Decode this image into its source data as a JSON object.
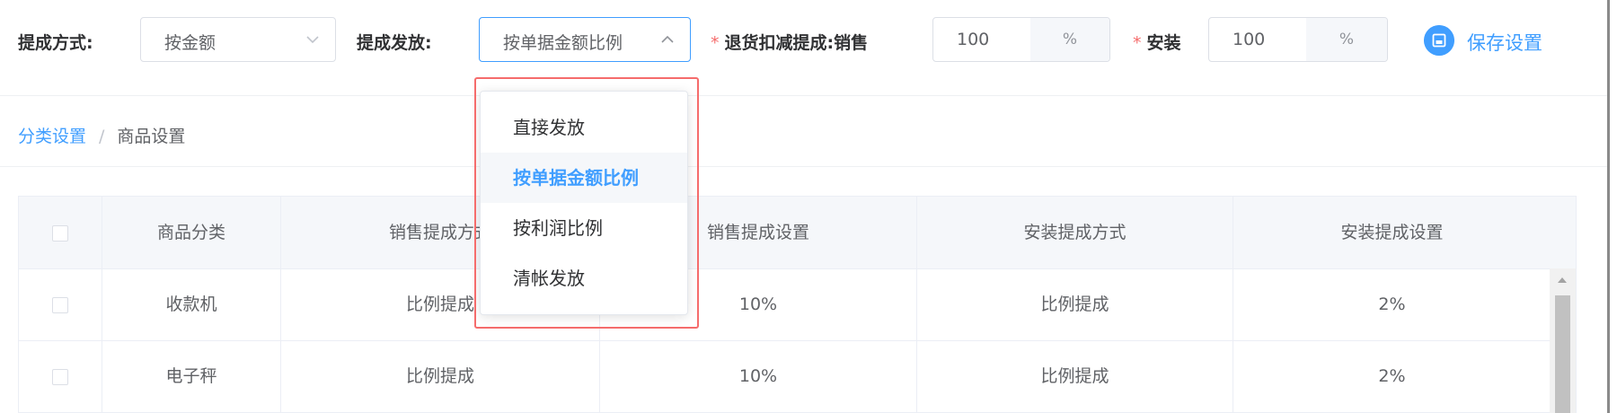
{
  "toolbar": {
    "method_label": "提成方式:",
    "method_value": "按金额",
    "distribution_label": "提成发放:",
    "distribution_value": "按单据金额比例",
    "returns_label": "退货扣减提成:",
    "sales_label": "销售",
    "sales_value": "100",
    "sales_unit": "%",
    "install_label": "安装",
    "install_value": "100",
    "install_unit": "%",
    "save_label": "保存设置",
    "required_mark": "*"
  },
  "breadcrumb": {
    "items": [
      "分类设置",
      "商品设置"
    ],
    "separator": "/"
  },
  "dropdown": {
    "options": [
      "直接发放",
      "按单据金额比例",
      "按利润比例",
      "清帐发放"
    ],
    "selected": "按单据金额比例"
  },
  "table": {
    "headers": [
      "商品分类",
      "销售提成方式",
      "销售提成设置",
      "安装提成方式",
      "安装提成设置"
    ],
    "rows": [
      [
        "收款机",
        "比例提成",
        "10%",
        "比例提成",
        "2%"
      ],
      [
        "电子秤",
        "比例提成",
        "10%",
        "比例提成",
        "2%"
      ]
    ]
  },
  "colors": {
    "accent": "#409eff",
    "danger": "#f56c6c",
    "header_bg": "#f5f7fa"
  },
  "icons": [
    "chevron-down-icon",
    "chevron-up-icon",
    "save-icon",
    "scroll-up-arrow-icon"
  ]
}
